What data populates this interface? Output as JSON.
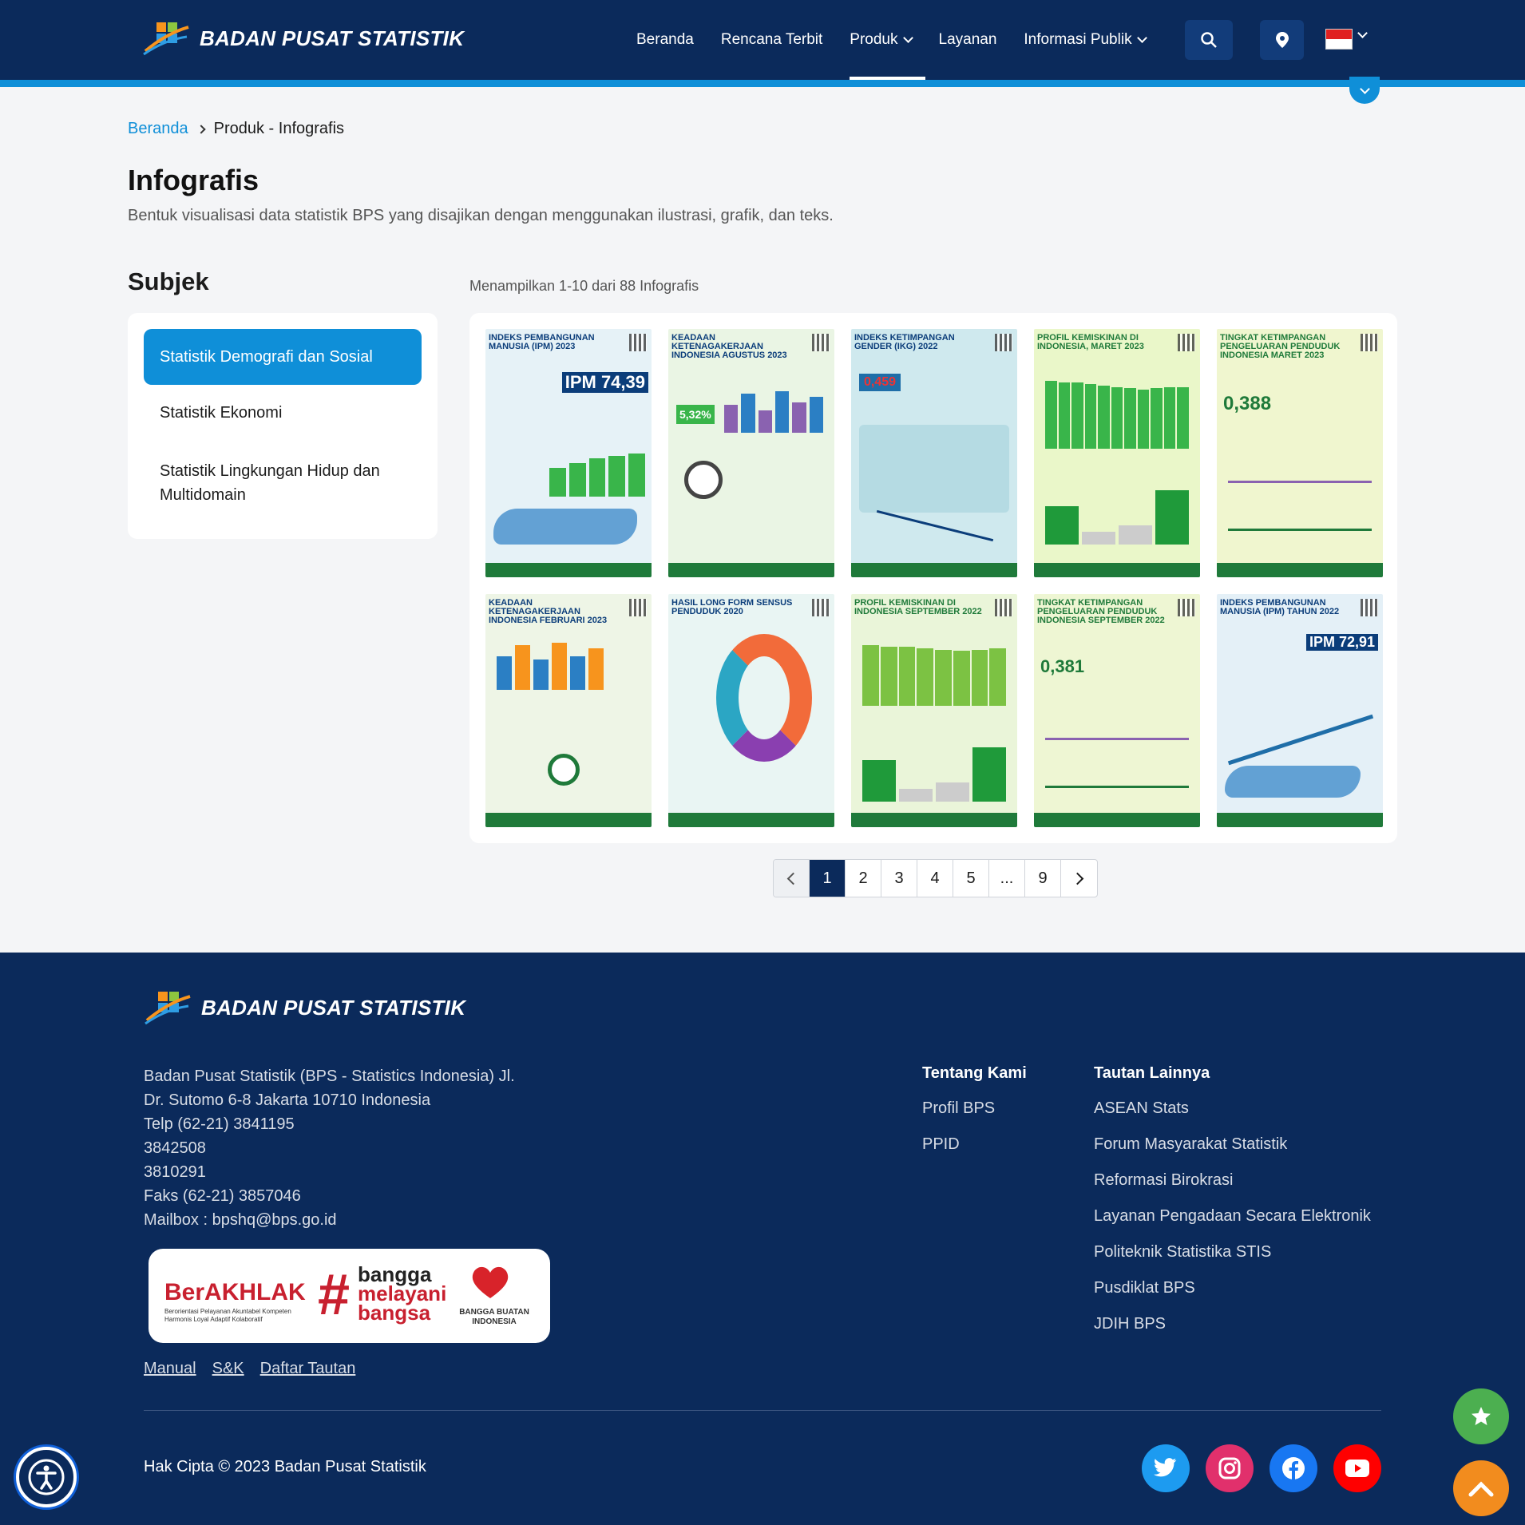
{
  "header": {
    "brand": "BADAN PUSAT STATISTIK",
    "nav": [
      {
        "label": "Beranda"
      },
      {
        "label": "Rencana Terbit"
      },
      {
        "label": "Produk"
      },
      {
        "label": "Layanan"
      },
      {
        "label": "Informasi Publik"
      }
    ]
  },
  "breadcrumb": {
    "home": "Beranda",
    "current": "Produk - Infografis"
  },
  "page": {
    "title": "Infografis",
    "description": "Bentuk visualisasi data statistik BPS yang disajikan dengan menggunakan ilustrasi, grafik, dan teks."
  },
  "subjek": {
    "title": "Subjek",
    "items": [
      {
        "label": "Statistik Demografi dan Sosial"
      },
      {
        "label": "Statistik Ekonomi"
      },
      {
        "label": "Statistik Lingkungan Hidup dan Multidomain"
      }
    ]
  },
  "results": {
    "summary": "Menampilkan 1-10 dari 88 Infografis"
  },
  "infografis": [
    {
      "title": "Indeks Pembangunan Manusia (IPM) 2023",
      "value": "IPM 74,39",
      "bg": "#e6f2f7"
    },
    {
      "title": "Keadaan Ketenagakerjaan Indonesia Agustus 2023",
      "value": "5,32%",
      "bg": "#eaf5e4"
    },
    {
      "title": "Indeks Ketimpangan Gender (IKG) 2022",
      "value": "0,459",
      "bg": "#cfe9ee"
    },
    {
      "title": "Profil Kemiskinan di Indonesia, Maret 2023",
      "value": "",
      "bg": "#eaf7c9"
    },
    {
      "title": "Tingkat Ketimpangan Pengeluaran Penduduk Indonesia Maret 2023",
      "value": "0,388",
      "bg": "#f0f6cf"
    },
    {
      "title": "Keadaan Ketenagakerjaan Indonesia Februari 2023",
      "value": "",
      "bg": "#eef5e6"
    },
    {
      "title": "Hasil Long Form Sensus Penduduk 2020",
      "value": "",
      "bg": "#e9f5f3"
    },
    {
      "title": "Profil Kemiskinan di Indonesia September 2022",
      "value": "",
      "bg": "#eaf5d9"
    },
    {
      "title": "Tingkat Ketimpangan Pengeluaran Penduduk Indonesia September 2022",
      "value": "0,381",
      "bg": "#eef6d3"
    },
    {
      "title": "Indeks Pembangunan Manusia (IPM) Tahun 2022",
      "value": "IPM 72,91",
      "bg": "#e4f0f7"
    }
  ],
  "pagination": {
    "pages": [
      "1",
      "2",
      "3",
      "4",
      "5",
      "...",
      "9"
    ],
    "current": "1"
  },
  "footer": {
    "brand": "BADAN PUSAT STATISTIK",
    "address": [
      "Badan Pusat Statistik (BPS - Statistics Indonesia) Jl.",
      "Dr. Sutomo 6-8 Jakarta 10710 Indonesia",
      "Telp (62-21) 3841195",
      "3842508",
      "3810291",
      "Faks (62-21) 3857046",
      "Mailbox : bpshq@bps.go.id"
    ],
    "badge": {
      "berakhlak": "BerAKHLAK",
      "berakhlak_sub": "Berorientasi Pelayanan Akuntabel Kompeten Harmonis Loyal Adaptif Kolaboratif",
      "tag1": "bangga",
      "tag2": "melayani",
      "tag3": "bangsa",
      "bbi": "BANGGA BUATAN INDONESIA"
    },
    "links": [
      "Manual",
      "S&K",
      "Daftar Tautan"
    ],
    "tentang": {
      "title": "Tentang Kami",
      "items": [
        "Profil BPS",
        "PPID"
      ]
    },
    "tautan": {
      "title": "Tautan Lainnya",
      "items": [
        "ASEAN Stats",
        "Forum Masyarakat Statistik",
        "Reformasi Birokrasi",
        "Layanan Pengadaan Secara Elektronik",
        "Politeknik Statistika STIS",
        "Pusdiklat BPS",
        "JDIH BPS"
      ]
    },
    "copyright": "Hak Cipta © 2023 Badan Pusat Statistik"
  },
  "colors": {
    "primary": "#0b2a5b",
    "accent": "#0f8fd8",
    "green": "#4caf50",
    "orange": "#f28c1e"
  }
}
